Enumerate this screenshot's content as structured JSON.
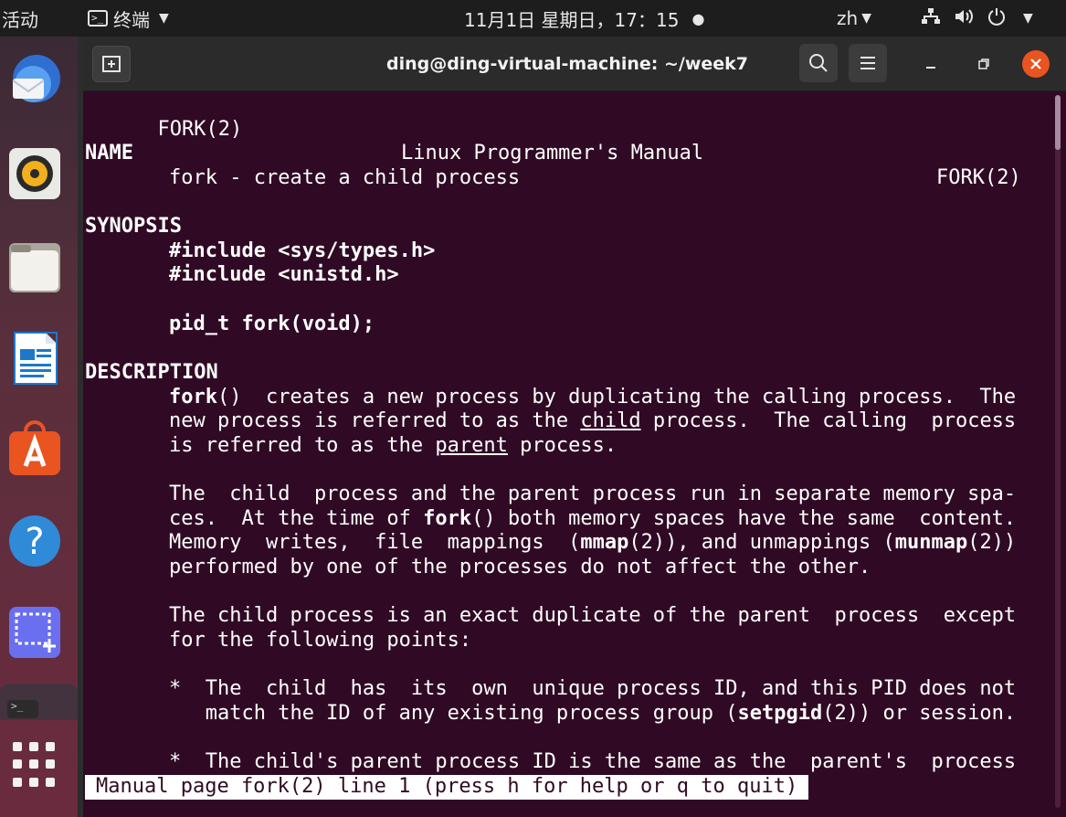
{
  "topbar": {
    "activities": "活动",
    "app_name": "终端",
    "clock": "11月1日 星期日，17：15",
    "clock_dot": "●",
    "lang": "zh"
  },
  "window": {
    "title": "ding@ding-virtual-machine: ~/week7"
  },
  "dock": {
    "items": [
      "thunderbird-icon",
      "rhythmbox-icon",
      "files-icon",
      "libreoffice-writer-icon",
      "ubuntu-software-icon",
      "help-icon",
      "screenshot-icon",
      "terminal-icon",
      "show-applications-icon"
    ],
    "terminal_glyph": ">_"
  },
  "manpage": {
    "header_left": "FORK(2)",
    "header_center": "Linux Programmer's Manual",
    "header_right": "FORK(2)",
    "name_heading": "NAME",
    "name_text": "fork - create a child process",
    "synopsis_heading": "SYNOPSIS",
    "include1": "#include <sys/types.h>",
    "include2": "#include <unistd.h>",
    "proto": "pid_t fork(void);",
    "description_heading": "DESCRIPTION",
    "d1_fork": "fork",
    "d1_a": "()  creates a new process by duplicating the calling process.  The",
    "d2_a": "new process is referred to as the ",
    "d2_child": "child",
    "d2_b": " process.  The calling  process",
    "d3_a": "is referred to as the ",
    "d3_parent": "parent",
    "d3_b": " process.",
    "p2_l1": "The  child  process and the parent process run in separate memory spa‐",
    "p2_l2a": "ces.  At the time of ",
    "p2_l2_fork": "fork",
    "p2_l2b": "() both memory spaces have the same  content.",
    "p2_l3a": "Memory  writes,  file  mappings  (",
    "p2_l3_mmap": "mmap",
    "p2_l3b": "(2)), and unmappings (",
    "p2_l3_munmap": "munmap",
    "p2_l3c": "(2))",
    "p2_l4": "performed by one of the processes do not affect the other.",
    "p3_l1": "The child process is an exact duplicate of the parent  process  except",
    "p3_l2": "for the following points:",
    "b1_l1": "*  The  child  has  its  own  unique process ID, and this PID does not",
    "b1_l2a": "   match the ID of any existing process group (",
    "b1_l2_setpgid": "setpgid",
    "b1_l2b": "(2)) or session.",
    "b2_l1": "*  The child's parent process ID is the same as the  parent's  process",
    "status": "Manual page fork(2) line 1 (press h for help or q to quit)"
  },
  "colors": {
    "terminal_bg": "#300a24",
    "accent": "#e95420",
    "topbar_bg": "#1d1d1d"
  }
}
